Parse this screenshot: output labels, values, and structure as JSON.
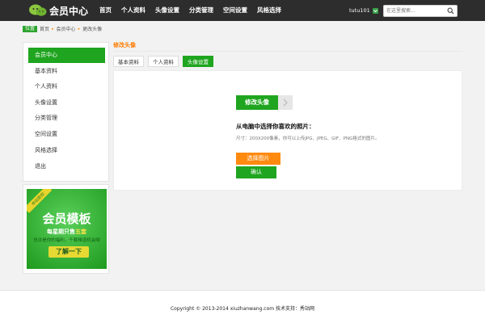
{
  "brand": {
    "logo_text": "会员中心"
  },
  "nav": {
    "items": [
      "首页",
      "个人资料",
      "头像设置",
      "分类管理",
      "空间设置",
      "风格选择"
    ]
  },
  "user": {
    "name": "tutu101"
  },
  "search": {
    "placeholder": "在这里搜索..."
  },
  "breadcrumb": {
    "tag": "位置",
    "items": [
      "首页",
      "会员中心",
      "更改头像"
    ],
    "separator": "▸"
  },
  "sidebar": {
    "items": [
      "会员中心",
      "基本资料",
      "个人资料",
      "头像设置",
      "分类管理",
      "空间设置",
      "风格选择",
      "退出"
    ],
    "active_index": 0
  },
  "promo": {
    "ribbon": "本站原创",
    "title": "会员模板",
    "subtitle_prefix": "每星期只售",
    "subtitle_highlight": "五套",
    "desc": "也许是你的福利，千载难逢机会呦",
    "button": "了解一下"
  },
  "section": {
    "title": "修改头像"
  },
  "tabs": {
    "items": [
      "基本资料",
      "个人资料",
      "头像设置"
    ],
    "active_index": 2
  },
  "panel": {
    "upload_label": "修改头像",
    "heading": "从电脑中选择你喜欢的照片：",
    "hint": "尺寸：200X200像素，你可以上传JPG、JPEG、GIF、PNG格式的图片。",
    "choose_label": "选择图片",
    "confirm_label": "确认"
  },
  "footer": {
    "text": "Copyright © 2013-2014 xiuzhanwang.com 技术支持：秀站网"
  },
  "colors": {
    "green": "#1fa51f",
    "orange": "#ff8a0f",
    "topbar": "#2d2d2d"
  }
}
